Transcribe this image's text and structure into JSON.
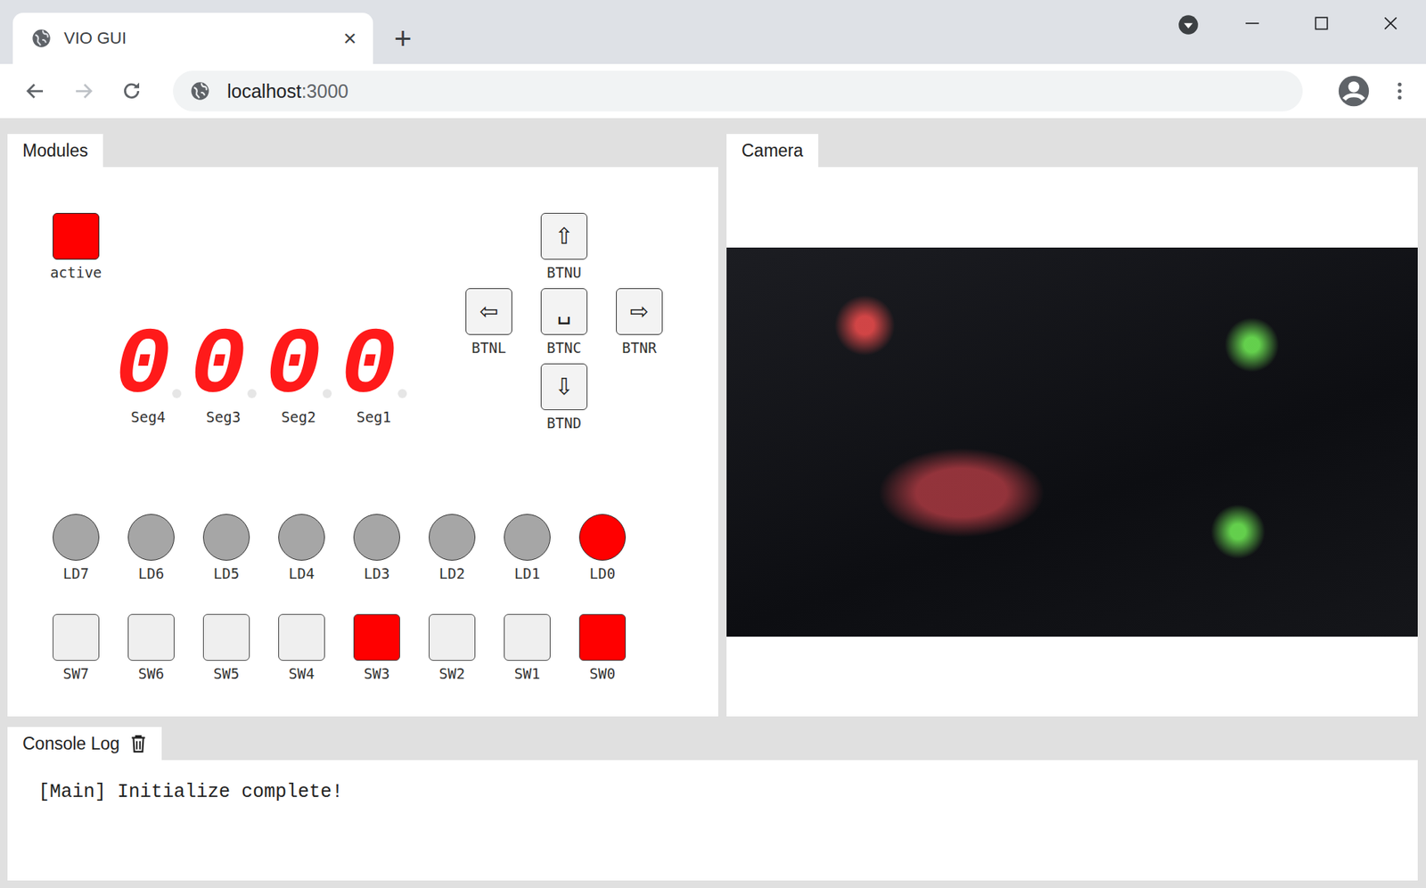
{
  "window": {
    "title": "VIO GUI",
    "close": "×",
    "new_tab": "+"
  },
  "address_bar": {
    "host": "localhost",
    "port": ":3000"
  },
  "modules": {
    "tab": {
      "label": "Modules",
      "selected": true
    },
    "active": {
      "label": "active",
      "on": true
    },
    "segments": [
      {
        "label": "Seg4",
        "digit": "0"
      },
      {
        "label": "Seg3",
        "digit": "0"
      },
      {
        "label": "Seg2",
        "digit": "0"
      },
      {
        "label": "Seg1",
        "digit": "0"
      }
    ],
    "buttons": [
      {
        "label": "BTNU",
        "glyph": "⇧",
        "pressed": false
      },
      {
        "label": "BTNL",
        "glyph": "⇦",
        "pressed": false
      },
      {
        "label": "BTNC",
        "glyph": "␣",
        "pressed": false
      },
      {
        "label": "BTNR",
        "glyph": "⇨",
        "pressed": false
      },
      {
        "label": "BTND",
        "glyph": "⇩",
        "pressed": false
      }
    ],
    "leds": [
      {
        "label": "LD7",
        "on": false
      },
      {
        "label": "LD6",
        "on": false
      },
      {
        "label": "LD5",
        "on": false
      },
      {
        "label": "LD4",
        "on": false
      },
      {
        "label": "LD3",
        "on": false
      },
      {
        "label": "LD2",
        "on": false
      },
      {
        "label": "LD1",
        "on": false
      },
      {
        "label": "LD0",
        "on": true
      }
    ],
    "switches": [
      {
        "label": "SW7",
        "on": false
      },
      {
        "label": "SW6",
        "on": false
      },
      {
        "label": "SW5",
        "on": false
      },
      {
        "label": "SW4",
        "on": false
      },
      {
        "label": "SW3",
        "on": true
      },
      {
        "label": "SW2",
        "on": false
      },
      {
        "label": "SW1",
        "on": false
      },
      {
        "label": "SW0",
        "on": true
      }
    ]
  },
  "camera": {
    "tab": {
      "label": "Camera",
      "selected": true
    }
  },
  "console": {
    "tab": {
      "label": "Console Log",
      "selected": true
    },
    "lines": [
      "[Main] Initialize complete!"
    ]
  }
}
